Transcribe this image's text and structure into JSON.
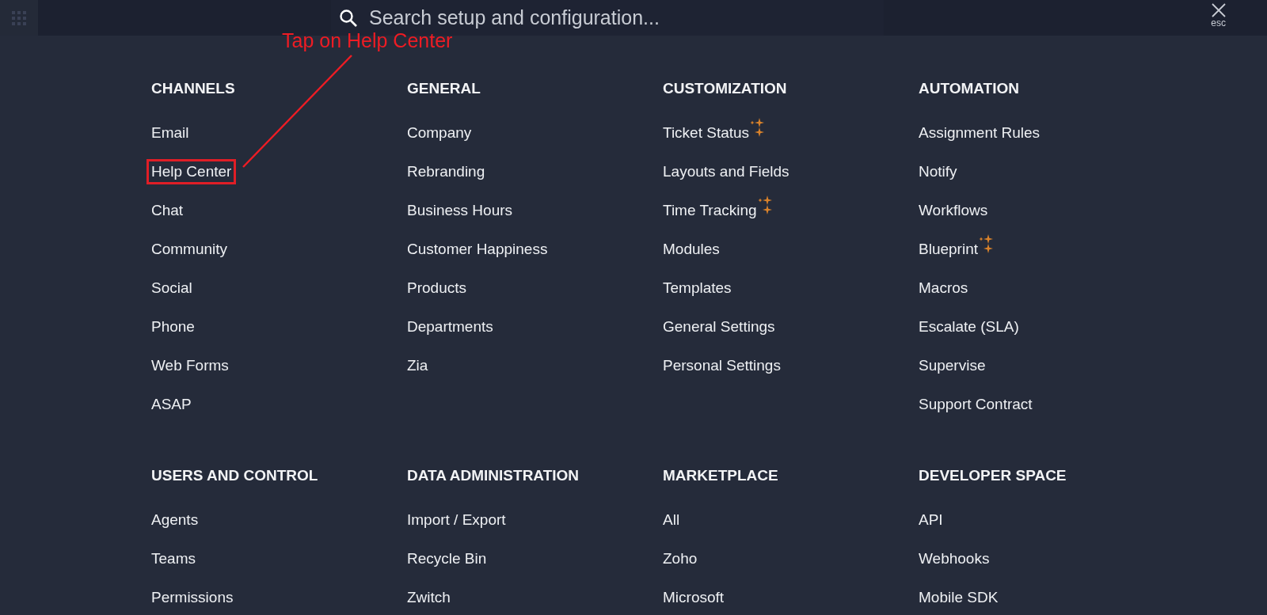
{
  "overlay": {
    "search": {
      "placeholder": "Search setup and configuration..."
    },
    "close": {
      "label": "esc"
    },
    "sections": [
      {
        "title": "CHANNELS",
        "items": [
          {
            "label": "Email",
            "new": false,
            "highlighted": false
          },
          {
            "label": "Help Center",
            "new": false,
            "highlighted": true
          },
          {
            "label": "Chat",
            "new": false,
            "highlighted": false
          },
          {
            "label": "Community",
            "new": false,
            "highlighted": false
          },
          {
            "label": "Social",
            "new": false,
            "highlighted": false
          },
          {
            "label": "Phone",
            "new": false,
            "highlighted": false
          },
          {
            "label": "Web Forms",
            "new": false,
            "highlighted": false
          },
          {
            "label": "ASAP",
            "new": false,
            "highlighted": false
          }
        ]
      },
      {
        "title": "GENERAL",
        "items": [
          {
            "label": "Company",
            "new": false,
            "highlighted": false
          },
          {
            "label": "Rebranding",
            "new": false,
            "highlighted": false
          },
          {
            "label": "Business Hours",
            "new": false,
            "highlighted": false
          },
          {
            "label": "Customer Happiness",
            "new": false,
            "highlighted": false
          },
          {
            "label": "Products",
            "new": false,
            "highlighted": false
          },
          {
            "label": "Departments",
            "new": false,
            "highlighted": false
          },
          {
            "label": "Zia",
            "new": false,
            "highlighted": false
          }
        ]
      },
      {
        "title": "CUSTOMIZATION",
        "items": [
          {
            "label": "Ticket Status",
            "new": true,
            "highlighted": false
          },
          {
            "label": "Layouts and Fields",
            "new": false,
            "highlighted": false
          },
          {
            "label": "Time Tracking",
            "new": true,
            "highlighted": false
          },
          {
            "label": "Modules",
            "new": false,
            "highlighted": false
          },
          {
            "label": "Templates",
            "new": false,
            "highlighted": false
          },
          {
            "label": "General Settings",
            "new": false,
            "highlighted": false
          },
          {
            "label": "Personal Settings",
            "new": false,
            "highlighted": false
          }
        ]
      },
      {
        "title": "AUTOMATION",
        "items": [
          {
            "label": "Assignment Rules",
            "new": false,
            "highlighted": false
          },
          {
            "label": "Notify",
            "new": false,
            "highlighted": false
          },
          {
            "label": "Workflows",
            "new": false,
            "highlighted": false
          },
          {
            "label": "Blueprint",
            "new": true,
            "highlighted": false
          },
          {
            "label": "Macros",
            "new": false,
            "highlighted": false
          },
          {
            "label": "Escalate (SLA)",
            "new": false,
            "highlighted": false
          },
          {
            "label": "Supervise",
            "new": false,
            "highlighted": false
          },
          {
            "label": "Support Contract",
            "new": false,
            "highlighted": false
          }
        ]
      },
      {
        "title": "USERS AND CONTROL",
        "items": [
          {
            "label": "Agents",
            "new": false,
            "highlighted": false
          },
          {
            "label": "Teams",
            "new": false,
            "highlighted": false
          },
          {
            "label": "Permissions",
            "new": false,
            "highlighted": false
          }
        ]
      },
      {
        "title": "DATA ADMINISTRATION",
        "items": [
          {
            "label": "Import / Export",
            "new": false,
            "highlighted": false
          },
          {
            "label": "Recycle Bin",
            "new": false,
            "highlighted": false
          },
          {
            "label": "Zwitch",
            "new": false,
            "highlighted": false
          }
        ]
      },
      {
        "title": "MARKETPLACE",
        "items": [
          {
            "label": "All",
            "new": false,
            "highlighted": false
          },
          {
            "label": "Zoho",
            "new": false,
            "highlighted": false
          },
          {
            "label": "Microsoft",
            "new": false,
            "highlighted": false
          }
        ]
      },
      {
        "title": "DEVELOPER SPACE",
        "items": [
          {
            "label": "API",
            "new": false,
            "highlighted": false
          },
          {
            "label": "Webhooks",
            "new": false,
            "highlighted": false
          },
          {
            "label": "Mobile SDK",
            "new": false,
            "highlighted": false
          }
        ]
      }
    ]
  },
  "annotation": {
    "text": "Tap on Help Center"
  }
}
